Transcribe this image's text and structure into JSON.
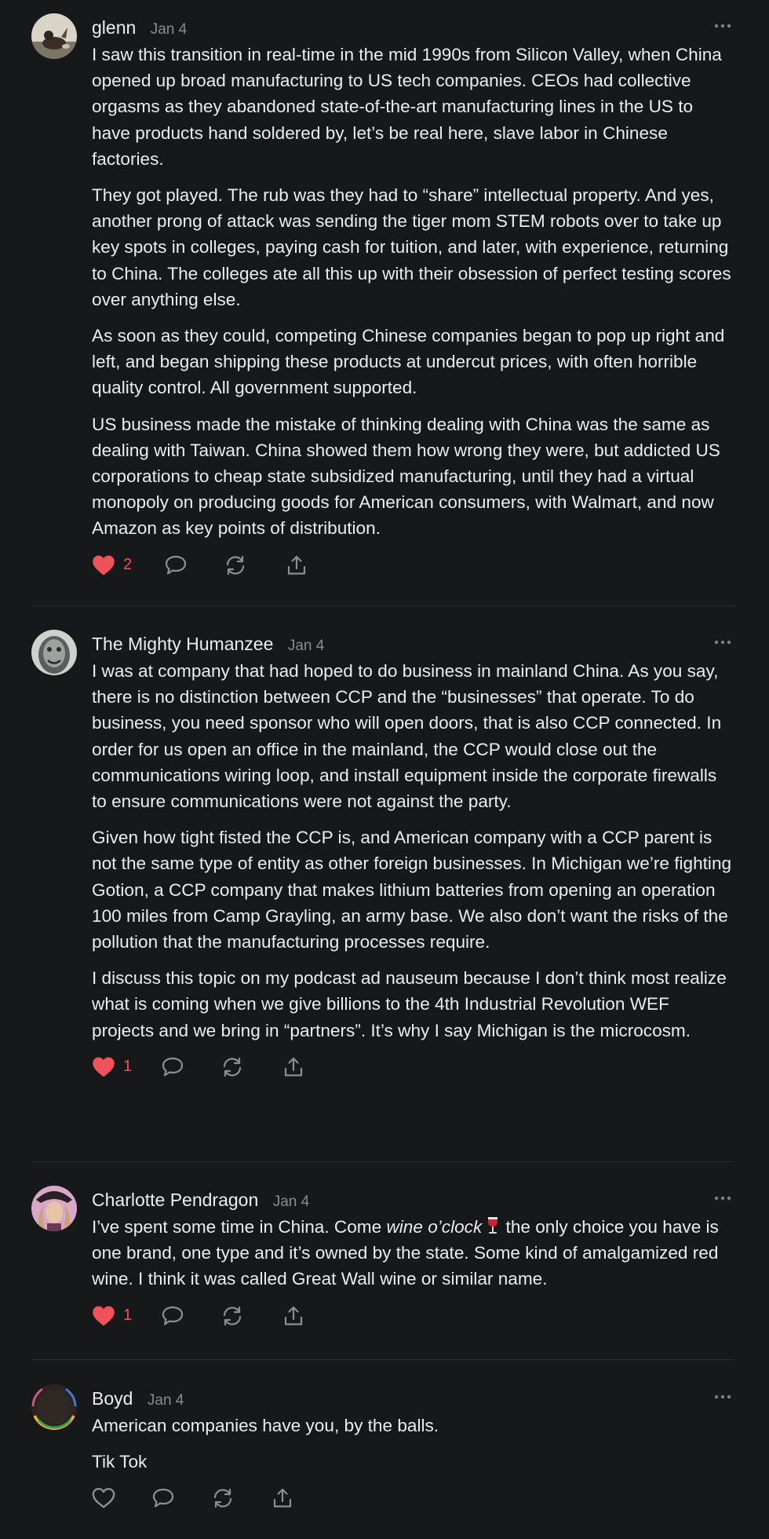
{
  "comments": [
    {
      "author": "glenn",
      "date": "Jan 4",
      "paragraphs": [
        "I saw this transition in real-time in the mid 1990s from Silicon Valley, when China opened up broad manufacturing to US tech companies. CEOs had collective orgasms as they abandoned state-of-the-art manufacturing lines in the US to have products hand soldered by, let’s be real here, slave labor in Chinese factories.",
        "They got played. The rub was they had to “share” intellectual property. And yes, another prong of attack was sending the tiger mom STEM robots over to take up key spots in colleges, paying cash for tuition, and later, with experience, returning to China. The colleges ate all this up with their obsession of perfect testing scores over anything else.",
        "As soon as they could, competing Chinese companies began to pop up right and left, and began shipping these products at undercut prices, with often horrible quality control. All government supported.",
        "US business made the mistake of thinking dealing with China was the same as dealing with Taiwan. China showed them how wrong they were, but addicted US corporations to cheap state subsidized manufacturing, until they had a virtual monopoly on producing goods for American consumers, with Walmart, and now Amazon as key points of distribution."
      ],
      "likes": "2",
      "liked": true
    },
    {
      "author": "The Mighty Humanzee",
      "date": "Jan 4",
      "paragraphs": [
        "I was at company that had hoped to do business in mainland China. As you say, there is no distinction between CCP and the “businesses” that operate. To do business, you need sponsor who will open doors, that is also CCP connected. In order for us open an office in the mainland, the CCP would close out the communications wiring loop, and install equipment inside the corporate firewalls to ensure communications were not against the party.",
        "Given how tight fisted the CCP is, and American company with a CCP parent is not the same type of entity as other foreign businesses. In Michigan we’re fighting Gotion, a CCP company that makes lithium batteries from opening an operation 100 miles from Camp Grayling, an army base. We also don’t want the risks of the pollution that the manufacturing processes require.",
        "I discuss this topic on my podcast ad nauseum because I don’t think most realize what is coming when we give billions to the 4th Industrial Revolution WEF projects and we bring in “partners”. It’s why I say Michigan is the microcosm."
      ],
      "likes": "1",
      "liked": true
    },
    {
      "author": "Charlotte Pendragon",
      "date": "Jan 4",
      "para_before": "I’ve spent some time in China. Come ",
      "para_italic": "wine o’clock",
      "para_after": " the only choice you have is one brand, one type and it’s owned by the state. Some kind of amalgamized red wine. I think it was called Great Wall wine or similar name.",
      "emoji": "wine-glass-icon",
      "likes": "1",
      "liked": true
    },
    {
      "author": "Boyd",
      "date": "Jan 4",
      "paragraphs": [
        "American companies have you, by the balls.",
        "Tik Tok"
      ],
      "likes": "",
      "liked": false
    }
  ],
  "icons": {
    "like": "heart-icon",
    "reply": "speech-bubble-icon",
    "restack": "restack-icon",
    "share": "share-icon",
    "more": "more-dots-icon"
  },
  "colors": {
    "background": "#17181a",
    "liked": "#f0525c",
    "muted": "#8a8b8f",
    "separator": "#2b2c2f"
  }
}
